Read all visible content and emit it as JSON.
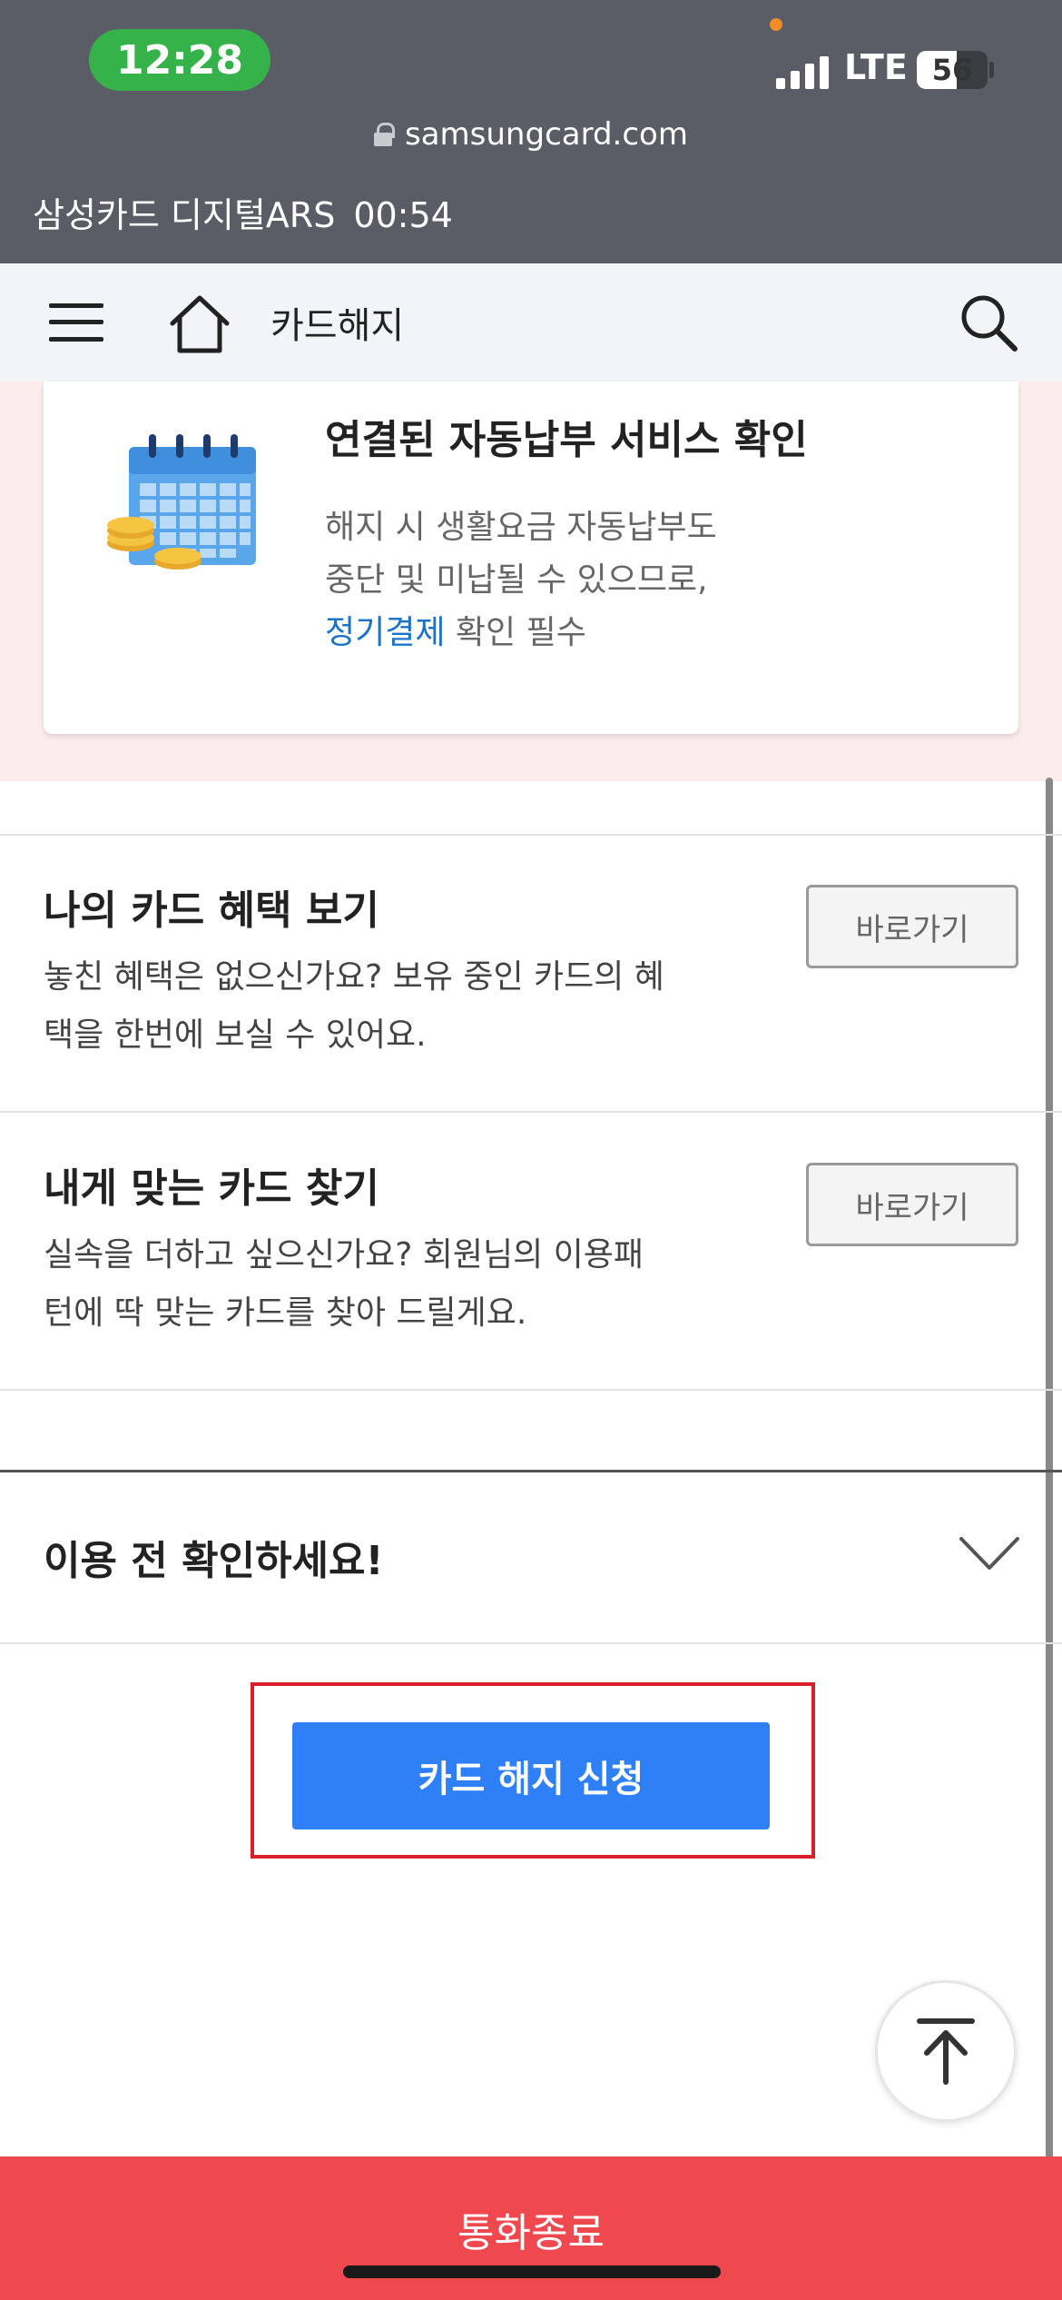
{
  "status_bar": {
    "time": "12:28",
    "network": "LTE",
    "battery": "56",
    "battery_level_percent": 56,
    "url": "samsungcard.com",
    "ars_title": "삼성카드 디지털ARS",
    "ars_timer": "00:54"
  },
  "header": {
    "title": "카드해지",
    "icons": [
      "menu-icon",
      "home-icon",
      "search-icon"
    ]
  },
  "notice_card": {
    "title": "연결된 자동납부 서비스 확인",
    "line1": "해지 시 생활요금 자동납부도",
    "line2": "중단 및 미납될 수 있으므로,",
    "link_text": "정기결제",
    "line3_suffix": " 확인 필수"
  },
  "shortcuts": [
    {
      "title": "나의 카드 혜택 보기",
      "desc_line1": "놓친 혜택은 없으신가요? 보유 중인 카드의 혜",
      "desc_line2": "택을 한번에 보실 수 있어요.",
      "button_label": "바로가기"
    },
    {
      "title": "내게 맞는 카드 찾기",
      "desc_line1": "실속을 더하고 싶으신가요? 회원님의 이용패",
      "desc_line2": "턴에 딱 맞는 카드를 찾아 드릴게요.",
      "button_label": "바로가기"
    }
  ],
  "accordion": {
    "title": "이용 전 확인하세요!"
  },
  "cta": {
    "label": "카드 해지 신청"
  },
  "end_call": {
    "label": "통화종료"
  },
  "colors": {
    "status_bar": "#5a5d66",
    "time_pill": "#35b24a",
    "header_bg": "#f3f4f8",
    "pink_bg": "#fdecec",
    "link": "#1a73c8",
    "cta": "#2f80f6",
    "highlight": "#d9202a",
    "end_call": "#f0484f"
  }
}
